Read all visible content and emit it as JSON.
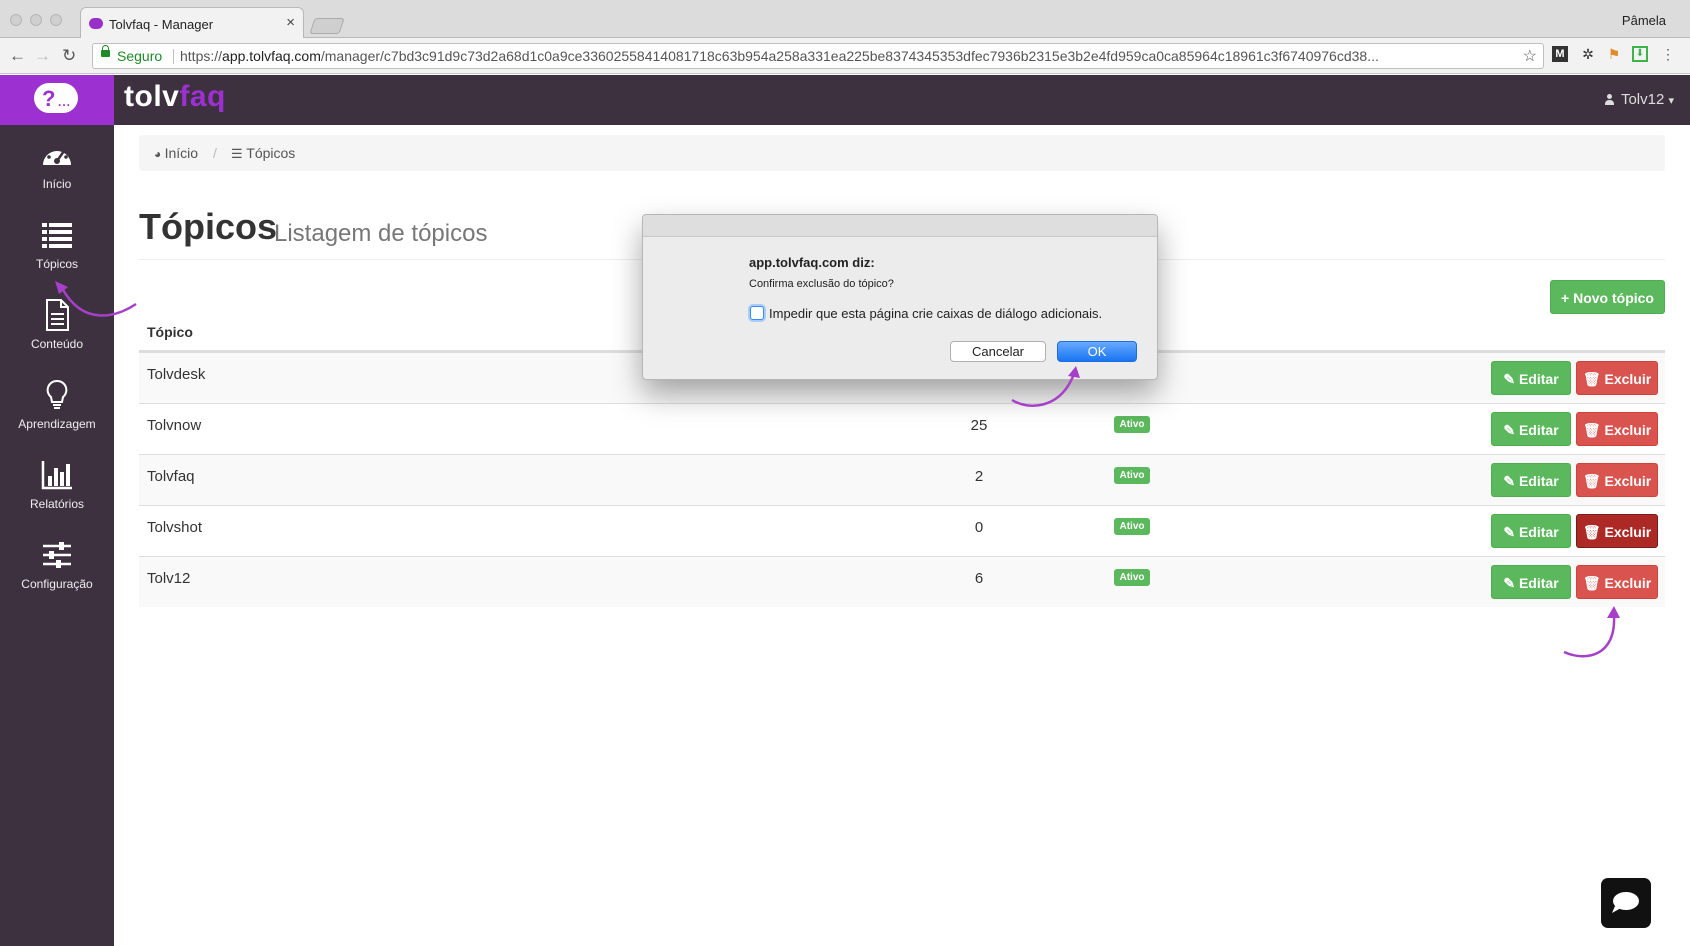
{
  "browser": {
    "tab_title": "Tolvfaq - Manager",
    "tab_close": "×",
    "profile_name": "Pâmela",
    "secure_label": "Seguro",
    "url_scheme": "https://",
    "url_host": "app.tolvfaq.com",
    "url_path": "/manager/c7bd3c91d9c73d2a68d1c0a9ce33602558414081718c63b954a258a331ea225be8374345353dfec7936b2315e3b2e4fd959ca0ca85964c18961c3f6740976cd38..."
  },
  "header": {
    "brand_main": "tolv",
    "brand_accent": "faq",
    "logo_glyph": "?",
    "logo_dots": "...",
    "user": "Tolv12",
    "user_caret": "▾"
  },
  "sidebar": {
    "items": [
      {
        "label": "Início",
        "icon": "dashboard-icon"
      },
      {
        "label": "Tópicos",
        "icon": "list-icon"
      },
      {
        "label": "Conteúdo",
        "icon": "document-icon"
      },
      {
        "label": "Aprendizagem",
        "icon": "lightbulb-icon"
      },
      {
        "label": "Relatórios",
        "icon": "bar-chart-icon"
      },
      {
        "label": "Configuração",
        "icon": "sliders-icon"
      }
    ]
  },
  "breadcrumb": {
    "home": "Início",
    "separator": "/",
    "current": "Tópicos"
  },
  "page": {
    "title": "Tópicos",
    "subtitle": "Listagem de tópicos"
  },
  "actions": {
    "new_topic": "Novo tópico",
    "edit": "Editar",
    "delete": "Excluir"
  },
  "table": {
    "header_topic": "Tópico",
    "rows": [
      {
        "name": "Tolvdesk",
        "count": "",
        "status": ""
      },
      {
        "name": "Tolvnow",
        "count": "25",
        "status": "Ativo"
      },
      {
        "name": "Tolvfaq",
        "count": "2",
        "status": "Ativo"
      },
      {
        "name": "Tolvshot",
        "count": "0",
        "status": "Ativo"
      },
      {
        "name": "Tolv12",
        "count": "6",
        "status": "Ativo"
      }
    ]
  },
  "dialog": {
    "title": "app.tolvfaq.com diz:",
    "message": "Confirma exclusão do tópico?",
    "checkbox_label": "Impedir que esta página crie caixas de diálogo adicionais.",
    "cancel": "Cancelar",
    "ok": "OK"
  },
  "colors": {
    "brand": "#9d30d1",
    "header_bg": "#3d3140",
    "success": "#5cb85c",
    "danger": "#d9534f",
    "annotation": "#a640c8"
  }
}
